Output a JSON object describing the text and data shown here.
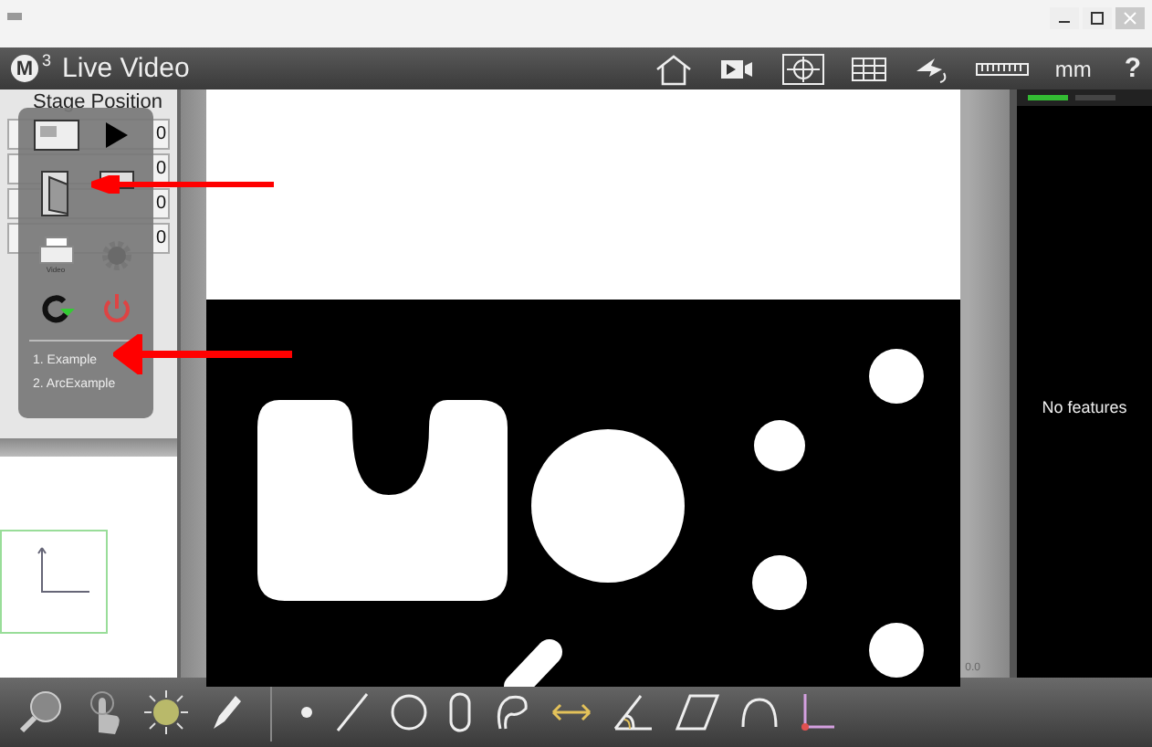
{
  "header": {
    "logo_letter": "M",
    "logo_sup": "3",
    "title": "Live Video",
    "units": "mm",
    "help": "?"
  },
  "stage": {
    "title": "Stage Position",
    "rows": [
      {
        "value": "0"
      },
      {
        "value": "0"
      },
      {
        "value": "0"
      },
      {
        "value": "0"
      }
    ]
  },
  "menu": {
    "print_caption": "Video",
    "programs": [
      {
        "label": "1. Example",
        "selected": false
      },
      {
        "label": "2. ArcExample",
        "selected": false
      }
    ]
  },
  "features_panel": {
    "empty_text": "No features"
  },
  "video": {
    "corner_text": "0.0"
  }
}
